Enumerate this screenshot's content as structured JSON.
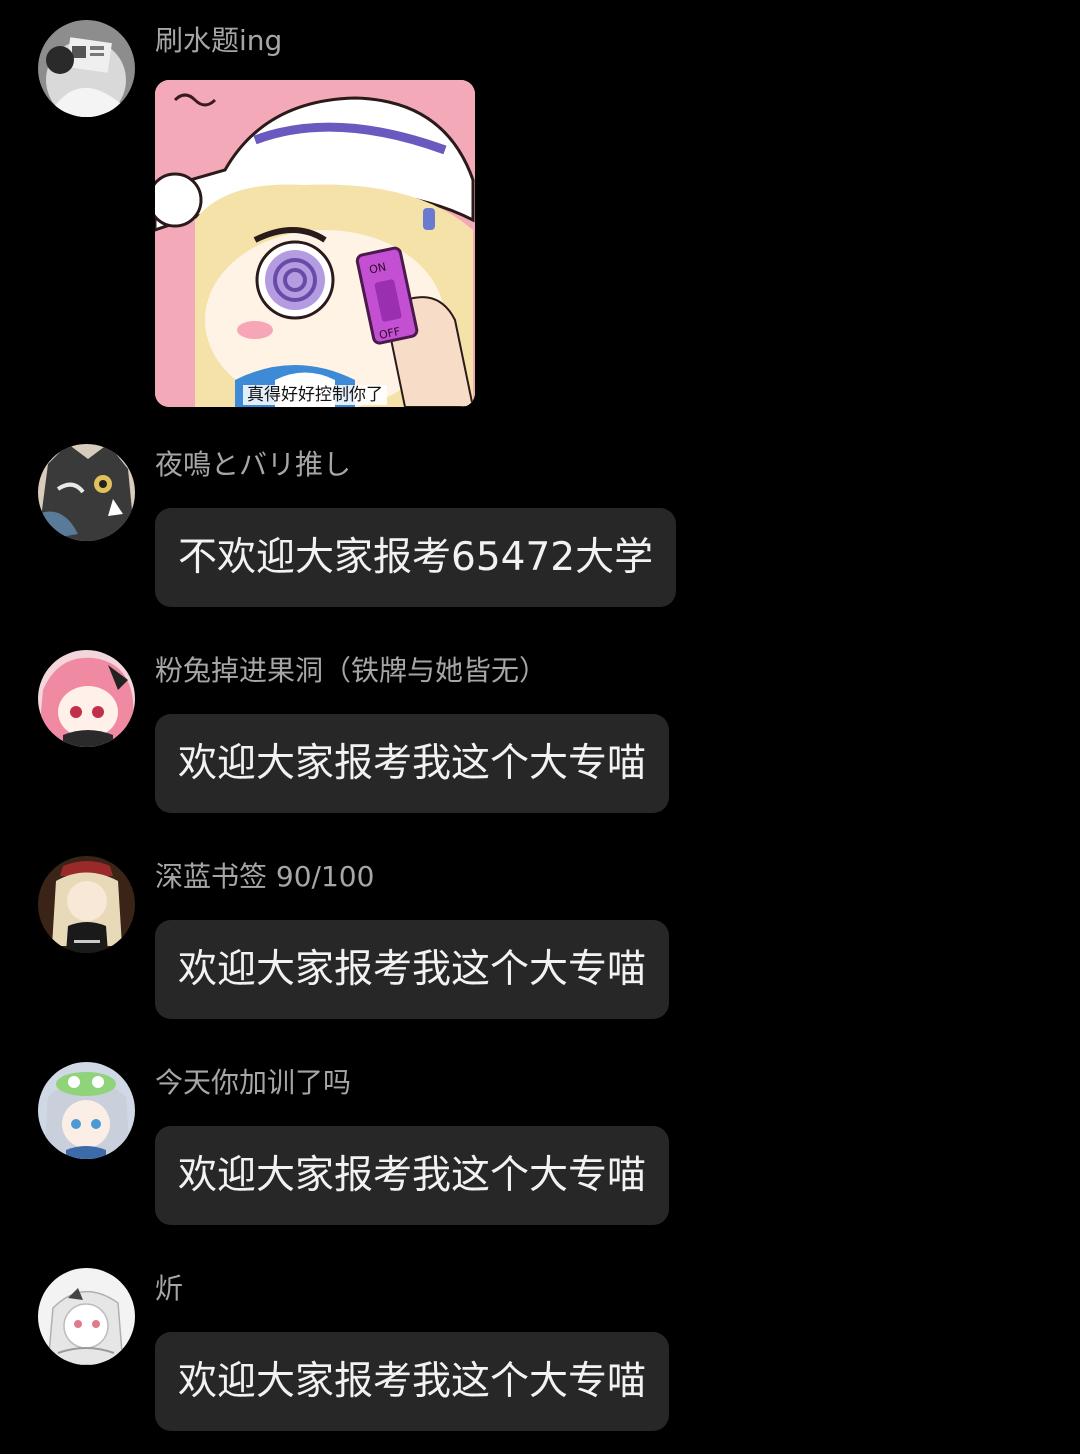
{
  "messages": [
    {
      "sender": "刷水题ing",
      "avatar_icon": "person-reading-newspaper-avatar",
      "sticker": {
        "icon": "anime-girl-dizzy-switch-sticker",
        "caption": "真得好好控制你了",
        "switch_on": "ON",
        "switch_off": "OFF"
      }
    },
    {
      "sender": "夜鳴とバリ推し",
      "avatar_icon": "dark-dragon-avatar",
      "text": "不欢迎大家报考65472大学"
    },
    {
      "sender": "粉兔掉进果洞（铁牌与她皆无）",
      "avatar_icon": "pink-hair-anime-girl-avatar",
      "text": "欢迎大家报考我这个大专喵"
    },
    {
      "sender": "深蓝书签 90/100",
      "avatar_icon": "blonde-anime-girl-avatar",
      "text": "欢迎大家报考我这个大专喵"
    },
    {
      "sender": "今天你加训了吗",
      "avatar_icon": "silver-hair-frog-hat-girl-avatar",
      "text": "欢迎大家报考我这个大专喵"
    },
    {
      "sender": "炘",
      "avatar_icon": "white-hair-sketch-girl-avatar",
      "text": "欢迎大家报考我这个大专喵"
    }
  ]
}
